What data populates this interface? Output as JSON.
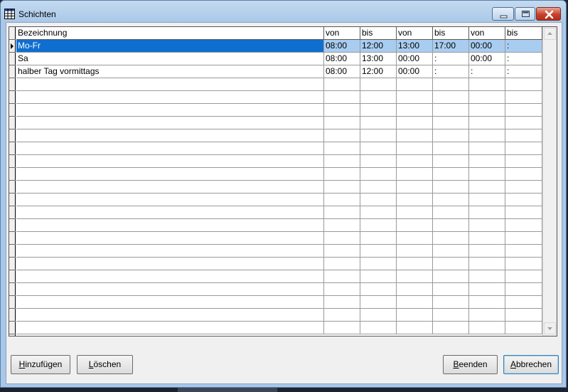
{
  "window": {
    "title": "Schichten",
    "icon": "grid-icon"
  },
  "titlebar_buttons": {
    "minimize": "minimize-icon",
    "maximize": "maximize-icon",
    "close": "close-icon"
  },
  "grid": {
    "columns": [
      "Bezeichnung",
      "von",
      "bis",
      "von",
      "bis",
      "von",
      "bis"
    ],
    "rows": [
      {
        "selected": true,
        "cells": [
          "Mo-Fr",
          "08:00",
          "12:00",
          "13:00",
          "17:00",
          "00:00",
          ":"
        ]
      },
      {
        "selected": false,
        "cells": [
          "Sa",
          "08:00",
          "13:00",
          "00:00",
          ":",
          "00:00",
          ":"
        ]
      },
      {
        "selected": false,
        "cells": [
          "halber Tag vormittags",
          "08:00",
          "12:00",
          "00:00",
          ":",
          ":",
          ":"
        ]
      }
    ],
    "empty_rows": 20
  },
  "buttons": {
    "add": "Hinzufügen",
    "delete": "Löschen",
    "finish": "Beenden",
    "cancel": "Abbrechen"
  }
}
